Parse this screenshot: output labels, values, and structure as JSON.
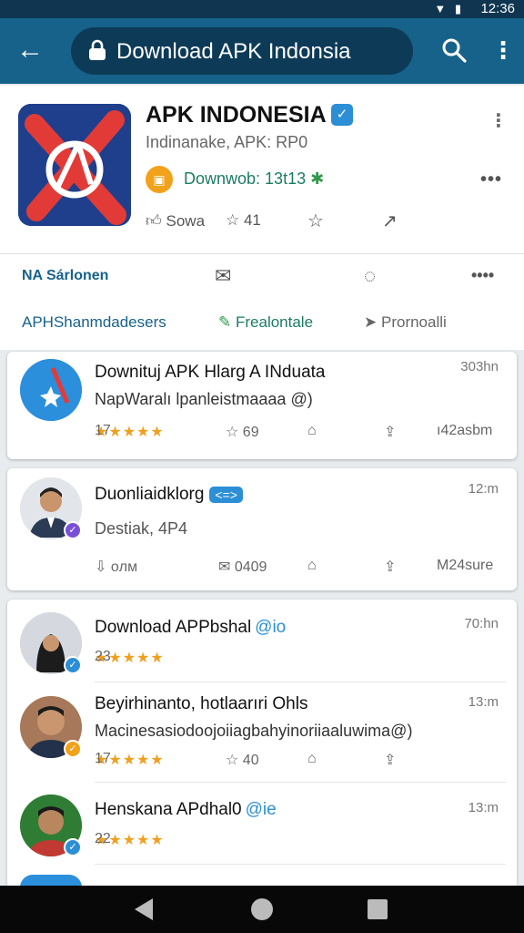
{
  "status_bar": {
    "time": "12:36",
    "icons": [
      "wifi-icon",
      "battery-icon"
    ]
  },
  "app_bar": {
    "title": "Download APK Indonsia",
    "icons": [
      "back-arrow-icon",
      "lock-icon",
      "search-icon",
      "more-vert-icon"
    ]
  },
  "app_card": {
    "name": "APK INDONESIA",
    "subtitle": "Indinanake, APK: RP0",
    "downloads": "Downwob: 13t13",
    "actions": {
      "like": "Sowa",
      "rating": "41"
    },
    "row2": {
      "left": "NA Sárlonen"
    },
    "row3": {
      "label": "APHShanmdadesers",
      "primary": "Frealontale",
      "secondary": "Prornoalli"
    },
    "colors": {
      "accent": "#17628a",
      "verified": "#2c8fd6",
      "download_badge": "#f2a21a",
      "green": "#1b7c63"
    }
  },
  "feed": [
    {
      "title": "Downituj APK Hlarg A INduata",
      "body": "NapWaralı lpanleistmaaaa @)",
      "time": "303hn",
      "stars": "★★★★★",
      "rating_count": "17",
      "likes": "69",
      "right": "ı42asbm"
    },
    {
      "title": "Duonliaidklorg",
      "tag": "<=>",
      "body": "Destiak, 4P4",
      "time": "12:m",
      "reply": "oлм",
      "messages": "0409",
      "right": "M24sure"
    },
    {
      "title": "Download  APPbshal",
      "tag_text": "@io",
      "time": "70:hn",
      "stars": "★★★★★",
      "rating_count": "23"
    },
    {
      "title": "Beyirhinanto, hotlaarıri Ohls",
      "body": "Macinesasiodoojoiiagbahyinoriiaaluwima@)",
      "time": "13:m",
      "stars": "★★★★★",
      "rating_count": "17",
      "likes": "40"
    },
    {
      "title": "Henskana APdhal0",
      "tag_text": "@ie",
      "time": "13:m",
      "stars": "★★★★★",
      "rating_count": "22"
    }
  ]
}
